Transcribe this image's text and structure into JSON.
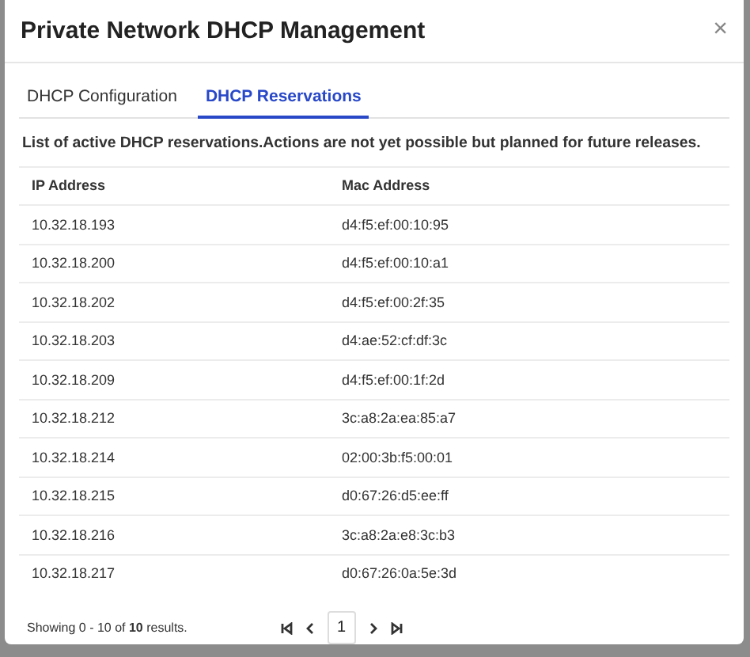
{
  "modal": {
    "title": "Private Network DHCP Management",
    "close": "×"
  },
  "tabs": [
    {
      "label": "DHCP Configuration",
      "selected": false
    },
    {
      "label": "DHCP Reservations",
      "selected": true
    }
  ],
  "description": "List of active DHCP reservations.Actions are not yet possible but planned for future releases.",
  "table": {
    "columns": [
      "IP Address",
      "Mac Address"
    ],
    "rows": [
      [
        "10.32.18.193",
        "d4:f5:ef:00:10:95"
      ],
      [
        "10.32.18.200",
        "d4:f5:ef:00:10:a1"
      ],
      [
        "10.32.18.202",
        "d4:f5:ef:00:2f:35"
      ],
      [
        "10.32.18.203",
        "d4:ae:52:cf:df:3c"
      ],
      [
        "10.32.18.209",
        "d4:f5:ef:00:1f:2d"
      ],
      [
        "10.32.18.212",
        "3c:a8:2a:ea:85:a7"
      ],
      [
        "10.32.18.214",
        "02:00:3b:f5:00:01"
      ],
      [
        "10.32.18.215",
        "d0:67:26:d5:ee:ff"
      ],
      [
        "10.32.18.216",
        "3c:a8:2a:e8:3c:b3"
      ],
      [
        "10.32.18.217",
        "d0:67:26:0a:5e:3d"
      ]
    ]
  },
  "pagination": {
    "summary": "Showing 0 - 10 of **10** results.",
    "pages": [
      {
        "label": "1",
        "selected": true
      }
    ]
  }
}
